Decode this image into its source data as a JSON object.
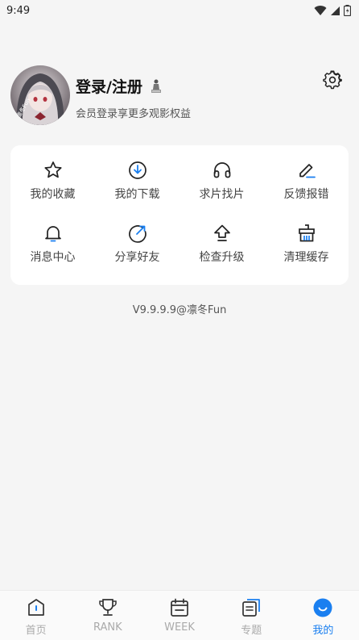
{
  "status_bar": {
    "time": "9:49",
    "icons": [
      "wifi-icon",
      "signal-icon",
      "battery-icon"
    ]
  },
  "profile": {
    "avatar_icon": "avatar-anime-girl",
    "name": "登录/注册",
    "badge_icon": "level-badge-icon",
    "subtitle": "会员登录享更多观影权益",
    "settings_icon": "gear-icon"
  },
  "functions": [
    {
      "label": "我的收藏",
      "icon": "star-icon"
    },
    {
      "label": "我的下载",
      "icon": "download-icon"
    },
    {
      "label": "求片找片",
      "icon": "headphones-icon"
    },
    {
      "label": "反馈报错",
      "icon": "edit-icon"
    },
    {
      "label": "消息中心",
      "icon": "bell-icon"
    },
    {
      "label": "分享好友",
      "icon": "share-icon"
    },
    {
      "label": "检查升级",
      "icon": "upgrade-icon"
    },
    {
      "label": "清理缓存",
      "icon": "clean-icon"
    }
  ],
  "version": "V9.9.9.9@凛冬Fun",
  "bottom_nav": {
    "items": [
      {
        "label": "首页",
        "icon": "home-icon"
      },
      {
        "label": "RANK",
        "icon": "trophy-icon"
      },
      {
        "label": "WEEK",
        "icon": "calendar-icon"
      },
      {
        "label": "专题",
        "icon": "topic-icon"
      },
      {
        "label": "我的",
        "icon": "profile-smile-icon"
      }
    ],
    "active_index": 4
  },
  "colors": {
    "accent": "#1a7ff0",
    "background": "#f5f5f5",
    "card": "#ffffff",
    "nav_inactive": "#aaaaaa"
  }
}
